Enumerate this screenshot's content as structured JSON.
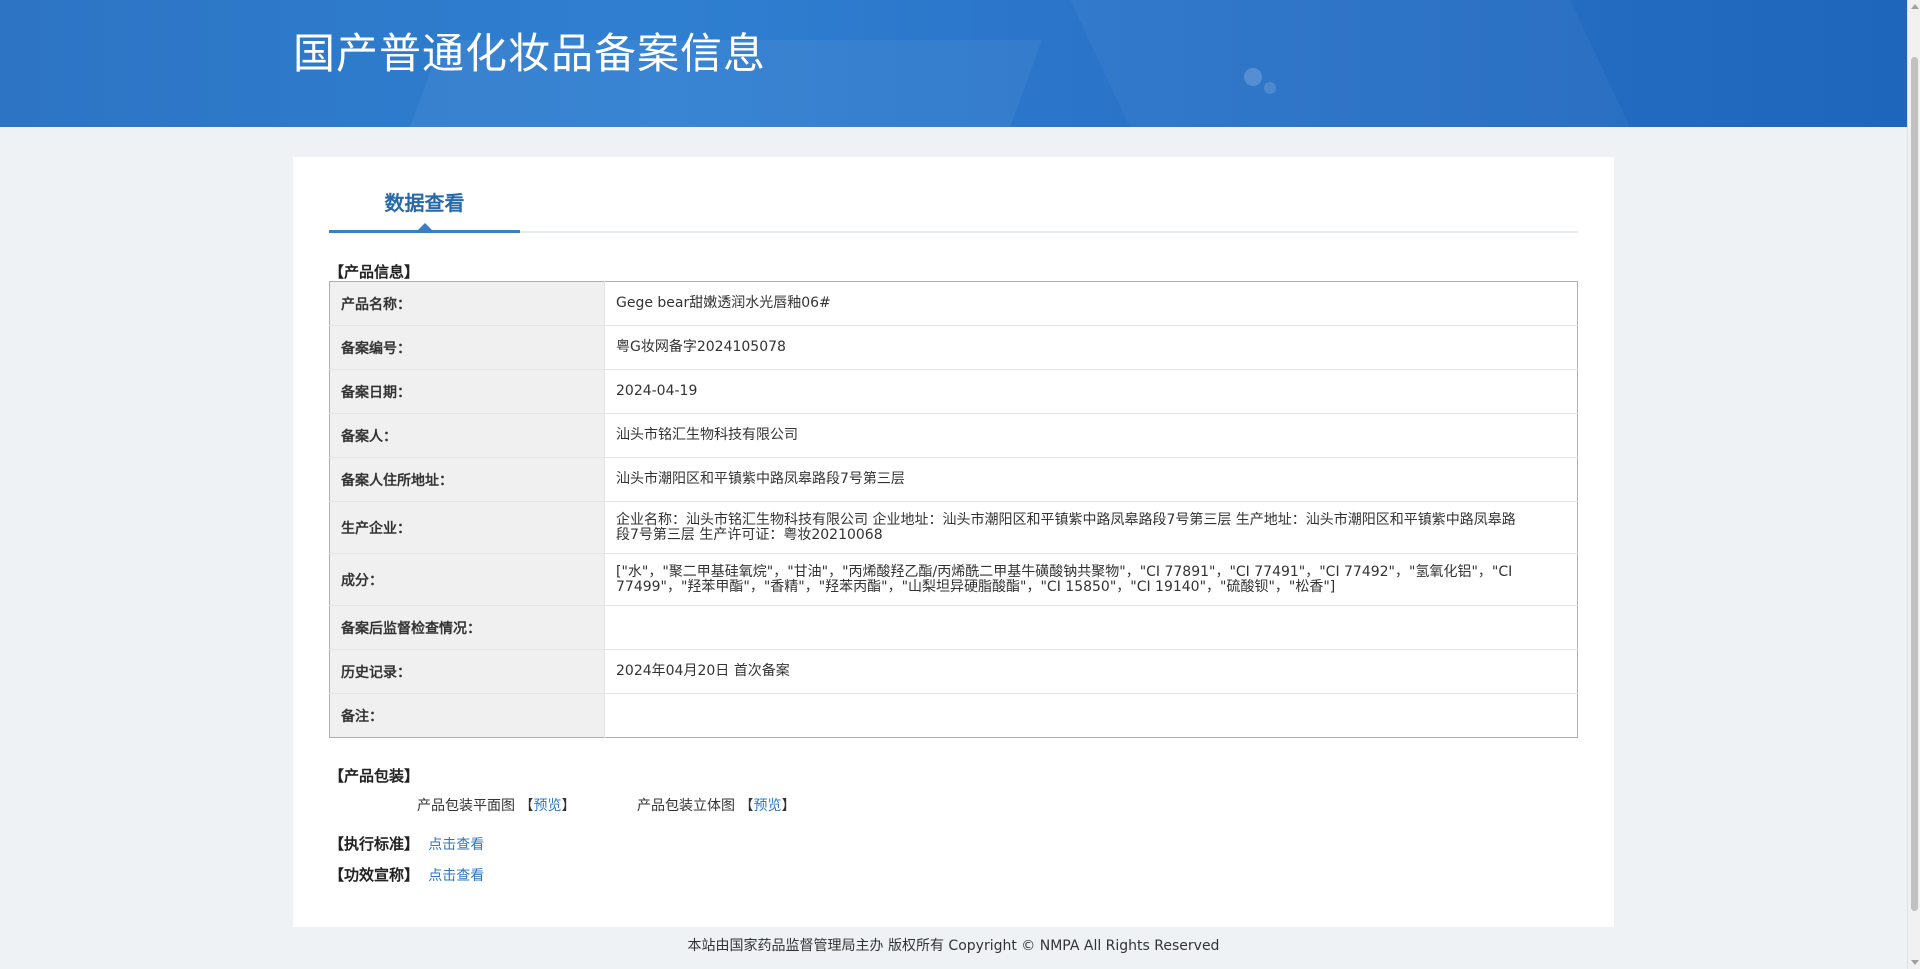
{
  "header": {
    "title": "国产普通化妆品备案信息"
  },
  "tabs": [
    {
      "label": "数据查看"
    }
  ],
  "product_info": {
    "section_title": "【产品信息】",
    "rows": [
      {
        "label": "产品名称：",
        "value": "Gege bear甜嫩透润水光唇釉06#"
      },
      {
        "label": "备案编号：",
        "value": "粤G妆网备字2024105078"
      },
      {
        "label": "备案日期：",
        "value": "2024-04-19"
      },
      {
        "label": "备案人：",
        "value": "汕头市铭汇生物科技有限公司"
      },
      {
        "label": "备案人住所地址：",
        "value": "汕头市潮阳区和平镇紫中路凤皋路段7号第三层"
      },
      {
        "label": "生产企业：",
        "value": "企业名称：汕头市铭汇生物科技有限公司 企业地址：汕头市潮阳区和平镇紫中路凤皋路段7号第三层 生产地址：汕头市潮阳区和平镇紫中路凤皋路段7号第三层 生产许可证：粤妆20210068"
      },
      {
        "label": "成分：",
        "value": "[\"水\"，\"聚二甲基硅氧烷\"，\"甘油\"，\"丙烯酸羟乙酯/丙烯酰二甲基牛磺酸钠共聚物\"，\"CI 77891\"，\"CI 77491\"，\"CI 77492\"，\"氢氧化铝\"，\"CI 77499\"，\"羟苯甲酯\"，\"香精\"，\"羟苯丙酯\"，\"山梨坦异硬脂酸酯\"，\"CI 15850\"，\"CI 19140\"，\"硫酸钡\"，\"松香\"]"
      },
      {
        "label": "备案后监督检查情况：",
        "value": ""
      },
      {
        "label": "历史记录：",
        "value": "2024年04月20日 首次备案"
      },
      {
        "label": "备注：",
        "value": ""
      }
    ]
  },
  "packaging": {
    "section_title": "【产品包装】",
    "flat_label": "产品包装平面图",
    "flat_link": "预览",
    "solid_label": "产品包装立体图",
    "solid_link": "预览",
    "bracket_open": "【",
    "bracket_close": "】"
  },
  "standard": {
    "section_title": "【执行标准】",
    "link": "点击查看"
  },
  "efficacy": {
    "section_title": "【功效宣称】",
    "link": "点击查看"
  },
  "footer": {
    "text": "本站由国家药品监督管理局主办 版权所有 Copyright © NMPA All Rights Reserved"
  }
}
